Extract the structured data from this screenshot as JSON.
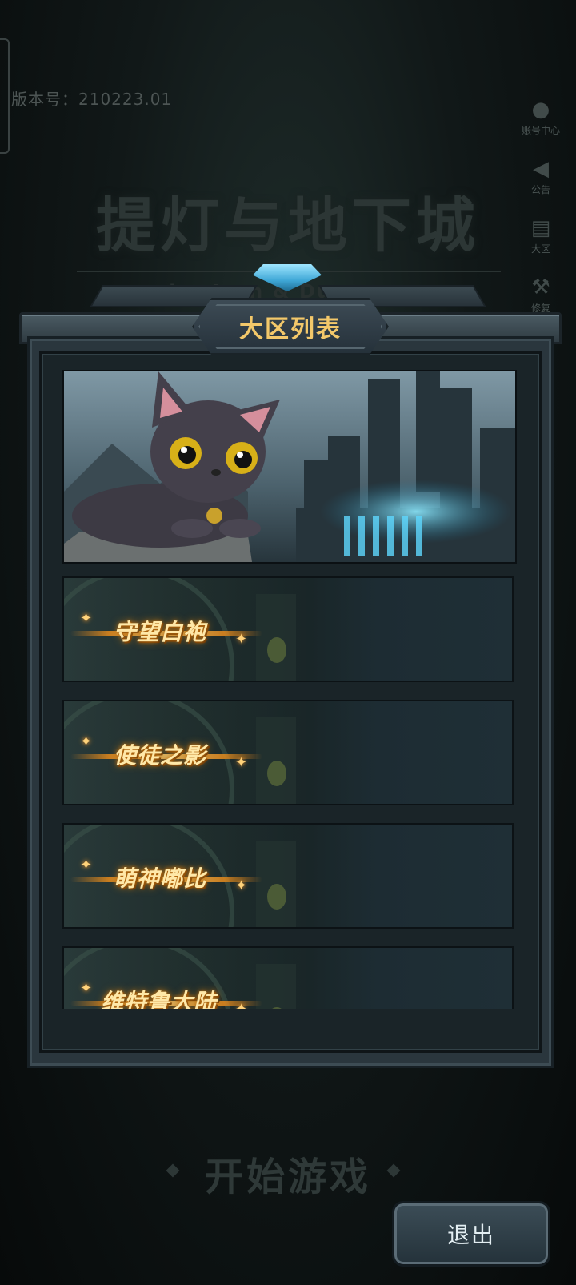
{
  "version_text": "版本号：210223.01",
  "side_menu": [
    {
      "label": "账号中心",
      "icon": "user-icon",
      "glyph": "👤"
    },
    {
      "label": "公告",
      "icon": "megaphone-icon",
      "glyph": "◀"
    },
    {
      "label": "大区",
      "icon": "radio-icon",
      "glyph": "📻"
    },
    {
      "label": "修复",
      "icon": "wrench-icon",
      "glyph": "🔧"
    }
  ],
  "game_title": "提灯与地下城",
  "game_subtitle": "Lantern & Dungeon",
  "modal": {
    "title": "大区列表",
    "servers": [
      {
        "name": "守望白袍"
      },
      {
        "name": "使徒之影"
      },
      {
        "name": "萌神嘟比"
      },
      {
        "name": "维特鲁大陆"
      }
    ]
  },
  "start_game_label": "开始游戏",
  "exit_label": "退出",
  "colors": {
    "accent_gold": "#f3c86a",
    "server_name": "#ffe8a8",
    "panel": "#2a363d",
    "castle_glow": "#4fd6ff"
  }
}
